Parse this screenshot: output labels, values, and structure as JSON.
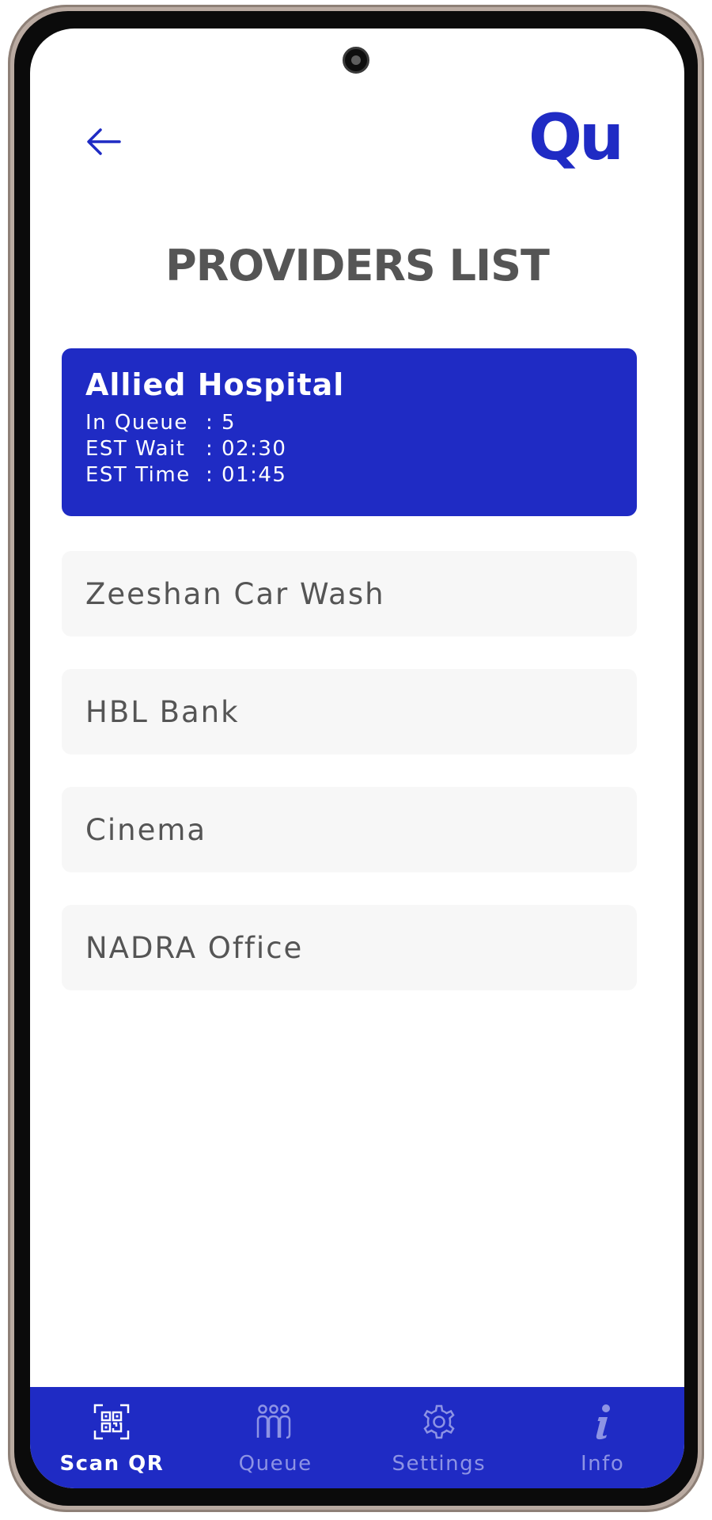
{
  "header": {
    "back_icon": "arrow-left-icon",
    "logo_text": "Qu",
    "title": "PROVIDERS LIST"
  },
  "colors": {
    "brand": "#1f2bc4",
    "card_bg": "#f7f7f7",
    "text_gray": "#555555",
    "nav_inactive": "#8d93e4"
  },
  "providers": {
    "selected": {
      "name": "Allied Hospital",
      "in_queue_label": "In Queue",
      "in_queue_value": ": 5",
      "est_wait_label": "EST Wait",
      "est_wait_value": ": 02:30",
      "est_time_label": "EST Time",
      "est_time_value": ": 01:45"
    },
    "items": [
      {
        "name": "Zeeshan Car Wash"
      },
      {
        "name": "HBL Bank"
      },
      {
        "name": "Cinema"
      },
      {
        "name": "NADRA Office"
      }
    ]
  },
  "bottom_nav": {
    "items": [
      {
        "label": "Scan QR",
        "icon": "qr-code-icon",
        "active": true
      },
      {
        "label": "Queue",
        "icon": "queue-people-icon",
        "active": false
      },
      {
        "label": "Settings",
        "icon": "gear-icon",
        "active": false
      },
      {
        "label": "Info",
        "icon": "info-icon",
        "active": false
      }
    ]
  }
}
